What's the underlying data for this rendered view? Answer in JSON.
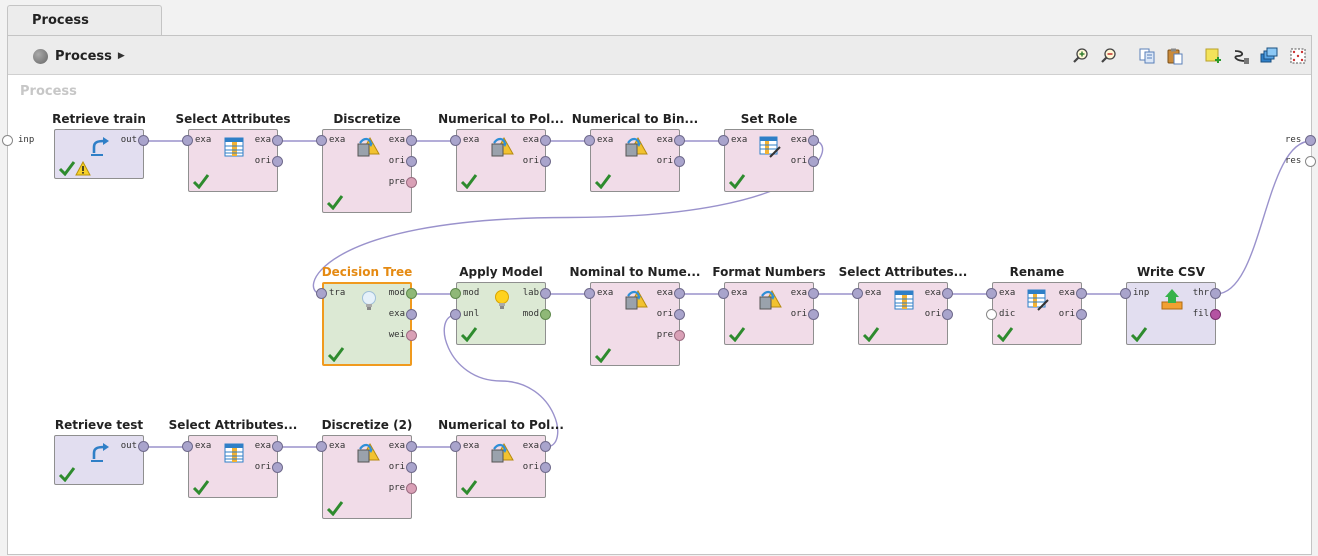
{
  "tab": {
    "title": "Process"
  },
  "breadcrumb": {
    "label": "Process"
  },
  "canvas": {
    "title": "Process"
  },
  "global_ports": {
    "input": [
      {
        "label": "inp"
      }
    ],
    "output": [
      {
        "label": "res"
      },
      {
        "label": "res"
      }
    ]
  },
  "toolbar": {
    "buttons": [
      {
        "icon": "zoom-in-icon"
      },
      {
        "icon": "zoom-out-icon"
      },
      {
        "icon": "copy-icon"
      },
      {
        "icon": "paste-icon"
      },
      {
        "icon": "add-note-icon"
      },
      {
        "icon": "auto-wire-icon"
      },
      {
        "icon": "arrange-layers-icon"
      },
      {
        "icon": "fit-grid-icon"
      }
    ]
  },
  "operators": [
    {
      "id": "retrieve-train",
      "title": "Retrieve train",
      "color": "lavender",
      "icon": "retrieve",
      "inputs": [],
      "outputs": [
        {
          "label": "out",
          "color": "blue"
        }
      ],
      "status": [
        "check",
        "warning"
      ]
    },
    {
      "id": "select-attributes",
      "title": "Select Attributes",
      "color": "pink",
      "icon": "table",
      "inputs": [
        {
          "label": "exa",
          "color": "blue"
        }
      ],
      "outputs": [
        {
          "label": "exa",
          "color": "blue"
        },
        {
          "label": "ori",
          "color": "blue"
        }
      ],
      "status": [
        "check"
      ]
    },
    {
      "id": "discretize",
      "title": "Discretize",
      "color": "pink",
      "icon": "convert",
      "inputs": [
        {
          "label": "exa",
          "color": "blue"
        }
      ],
      "outputs": [
        {
          "label": "exa",
          "color": "blue"
        },
        {
          "label": "ori",
          "color": "blue"
        },
        {
          "label": "pre",
          "color": "rose"
        }
      ],
      "status": [
        "check"
      ]
    },
    {
      "id": "numerical-to-polynominal",
      "title": "Numerical to Pol...",
      "color": "pink",
      "icon": "convert",
      "inputs": [
        {
          "label": "exa",
          "color": "blue"
        }
      ],
      "outputs": [
        {
          "label": "exa",
          "color": "blue"
        },
        {
          "label": "ori",
          "color": "blue"
        }
      ],
      "status": [
        "check"
      ]
    },
    {
      "id": "numerical-to-binominal",
      "title": "Numerical to Bin...",
      "color": "pink",
      "icon": "convert",
      "inputs": [
        {
          "label": "exa",
          "color": "blue"
        }
      ],
      "outputs": [
        {
          "label": "exa",
          "color": "blue"
        },
        {
          "label": "ori",
          "color": "blue"
        }
      ],
      "status": [
        "check"
      ]
    },
    {
      "id": "set-role",
      "title": "Set Role",
      "color": "pink",
      "icon": "table-edit",
      "inputs": [
        {
          "label": "exa",
          "color": "blue"
        }
      ],
      "outputs": [
        {
          "label": "exa",
          "color": "blue"
        },
        {
          "label": "ori",
          "color": "blue"
        }
      ],
      "status": [
        "check"
      ]
    },
    {
      "id": "decision-tree",
      "title": "Decision Tree",
      "color": "green",
      "selected": true,
      "icon": "bulb-off",
      "inputs": [
        {
          "label": "tra",
          "color": "blue"
        }
      ],
      "outputs": [
        {
          "label": "mod",
          "color": "green"
        },
        {
          "label": "exa",
          "color": "blue"
        },
        {
          "label": "wei",
          "color": "rose"
        }
      ],
      "status": [
        "check"
      ]
    },
    {
      "id": "apply-model",
      "title": "Apply Model",
      "color": "green",
      "icon": "bulb-on",
      "inputs": [
        {
          "label": "mod",
          "color": "green"
        },
        {
          "label": "unl",
          "color": "blue"
        }
      ],
      "outputs": [
        {
          "label": "lab",
          "color": "blue"
        },
        {
          "label": "mod",
          "color": "green"
        }
      ],
      "status": [
        "check"
      ]
    },
    {
      "id": "nominal-to-numerical",
      "title": "Nominal to Nume...",
      "color": "pink",
      "icon": "convert",
      "inputs": [
        {
          "label": "exa",
          "color": "blue"
        }
      ],
      "outputs": [
        {
          "label": "exa",
          "color": "blue"
        },
        {
          "label": "ori",
          "color": "blue"
        },
        {
          "label": "pre",
          "color": "rose"
        }
      ],
      "status": [
        "check"
      ]
    },
    {
      "id": "format-numbers",
      "title": "Format Numbers",
      "color": "pink",
      "icon": "convert",
      "inputs": [
        {
          "label": "exa",
          "color": "blue"
        }
      ],
      "outputs": [
        {
          "label": "exa",
          "color": "blue"
        },
        {
          "label": "ori",
          "color": "blue"
        }
      ],
      "status": [
        "check"
      ]
    },
    {
      "id": "select-attributes-2",
      "title": "Select Attributes...",
      "color": "pink",
      "icon": "table",
      "inputs": [
        {
          "label": "exa",
          "color": "blue"
        }
      ],
      "outputs": [
        {
          "label": "exa",
          "color": "blue"
        },
        {
          "label": "ori",
          "color": "blue"
        }
      ],
      "status": [
        "check"
      ]
    },
    {
      "id": "rename",
      "title": "Rename",
      "color": "pink",
      "icon": "table-edit",
      "inputs": [
        {
          "label": "exa",
          "color": "blue"
        },
        {
          "label": "dic",
          "color": "white"
        }
      ],
      "outputs": [
        {
          "label": "exa",
          "color": "blue"
        },
        {
          "label": "ori",
          "color": "blue"
        }
      ],
      "status": [
        "check"
      ]
    },
    {
      "id": "write-csv",
      "title": "Write CSV",
      "color": "lavender",
      "icon": "export",
      "inputs": [
        {
          "label": "inp",
          "color": "blue"
        }
      ],
      "outputs": [
        {
          "label": "thr",
          "color": "blue"
        },
        {
          "label": "fil",
          "color": "magenta"
        }
      ],
      "status": [
        "check"
      ]
    },
    {
      "id": "retrieve-test",
      "title": "Retrieve test",
      "color": "lavender",
      "icon": "retrieve",
      "inputs": [],
      "outputs": [
        {
          "label": "out",
          "color": "blue"
        }
      ],
      "status": [
        "check"
      ]
    },
    {
      "id": "select-attributes-3",
      "title": "Select Attributes...",
      "color": "pink",
      "icon": "table",
      "inputs": [
        {
          "label": "exa",
          "color": "blue"
        }
      ],
      "outputs": [
        {
          "label": "exa",
          "color": "blue"
        },
        {
          "label": "ori",
          "color": "blue"
        }
      ],
      "status": [
        "check"
      ]
    },
    {
      "id": "discretize-2",
      "title": "Discretize (2)",
      "color": "pink",
      "icon": "convert",
      "inputs": [
        {
          "label": "exa",
          "color": "blue"
        }
      ],
      "outputs": [
        {
          "label": "exa",
          "color": "blue"
        },
        {
          "label": "ori",
          "color": "blue"
        },
        {
          "label": "pre",
          "color": "rose"
        }
      ],
      "status": [
        "check"
      ]
    },
    {
      "id": "numerical-to-polynominal-2",
      "title": "Numerical to Pol...",
      "color": "pink",
      "icon": "convert",
      "inputs": [
        {
          "label": "exa",
          "color": "blue"
        }
      ],
      "outputs": [
        {
          "label": "exa",
          "color": "blue"
        },
        {
          "label": "ori",
          "color": "blue"
        }
      ],
      "status": [
        "check"
      ]
    }
  ],
  "connections": [
    {
      "from": "process-input.0",
      "to": ""
    },
    {
      "from": "retrieve-train.out.0",
      "to": "select-attributes.in.0"
    },
    {
      "from": "select-attributes.out.0",
      "to": "discretize.in.0"
    },
    {
      "from": "discretize.out.0",
      "to": "numerical-to-polynominal.in.0"
    },
    {
      "from": "numerical-to-polynominal.out.0",
      "to": "numerical-to-binominal.in.0"
    },
    {
      "from": "numerical-to-binominal.out.0",
      "to": "set-role.in.0"
    },
    {
      "from": "set-role.out.0",
      "to": "decision-tree.in.0"
    },
    {
      "from": "decision-tree.out.0",
      "to": "apply-model.in.0"
    },
    {
      "from": "apply-model.out.0",
      "to": "nominal-to-numerical.in.0"
    },
    {
      "from": "nominal-to-numerical.out.0",
      "to": "format-numbers.in.0"
    },
    {
      "from": "format-numbers.out.0",
      "to": "select-attributes-2.in.0"
    },
    {
      "from": "select-attributes-2.out.0",
      "to": "rename.in.0"
    },
    {
      "from": "rename.out.0",
      "to": "write-csv.in.0"
    },
    {
      "from": "write-csv.out.0",
      "to": "process-output.0"
    },
    {
      "from": "retrieve-test.out.0",
      "to": "select-attributes-3.in.0"
    },
    {
      "from": "select-attributes-3.out.0",
      "to": "discretize-2.in.0"
    },
    {
      "from": "discretize-2.out.0",
      "to": "numerical-to-polynominal-2.in.0"
    },
    {
      "from": "numerical-to-polynominal-2.out.0",
      "to": "apply-model.in.1"
    }
  ]
}
